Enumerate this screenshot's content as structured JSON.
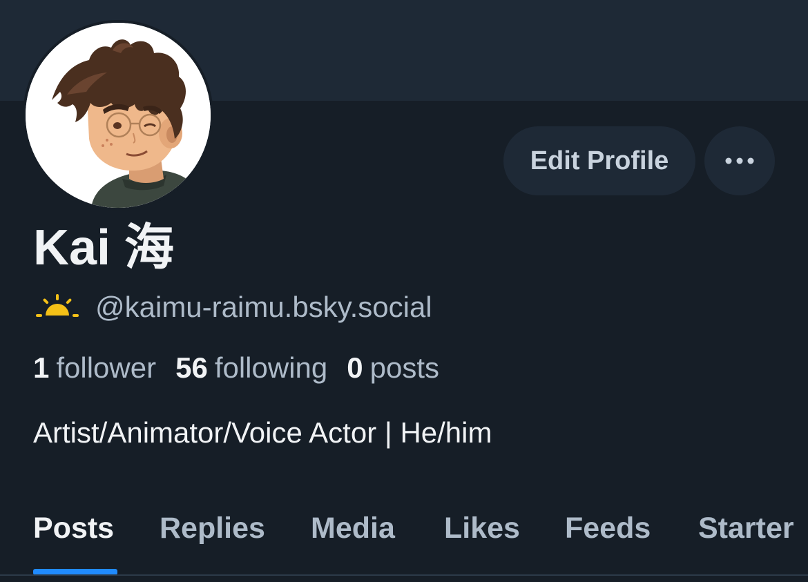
{
  "profile": {
    "display_name": "Kai 海",
    "handle": "@kaimu-raimu.bsky.social",
    "handle_icon": "sunrise-icon",
    "bio": "Artist/Animator/Voice Actor | He/him"
  },
  "actions": {
    "edit_label": "Edit Profile",
    "more_icon": "ellipsis-icon"
  },
  "stats": {
    "followers_count": "1",
    "followers_label": "follower",
    "following_count": "56",
    "following_label": "following",
    "posts_count": "0",
    "posts_label": "posts"
  },
  "tabs": [
    {
      "label": "Posts",
      "active": true
    },
    {
      "label": "Replies",
      "active": false
    },
    {
      "label": "Media",
      "active": false
    },
    {
      "label": "Likes",
      "active": false
    },
    {
      "label": "Feeds",
      "active": false
    },
    {
      "label": "Starter",
      "active": false
    }
  ],
  "colors": {
    "background": "#161e27",
    "banner": "#1e2936",
    "accent": "#208bfe",
    "sun": "#f5c117"
  }
}
